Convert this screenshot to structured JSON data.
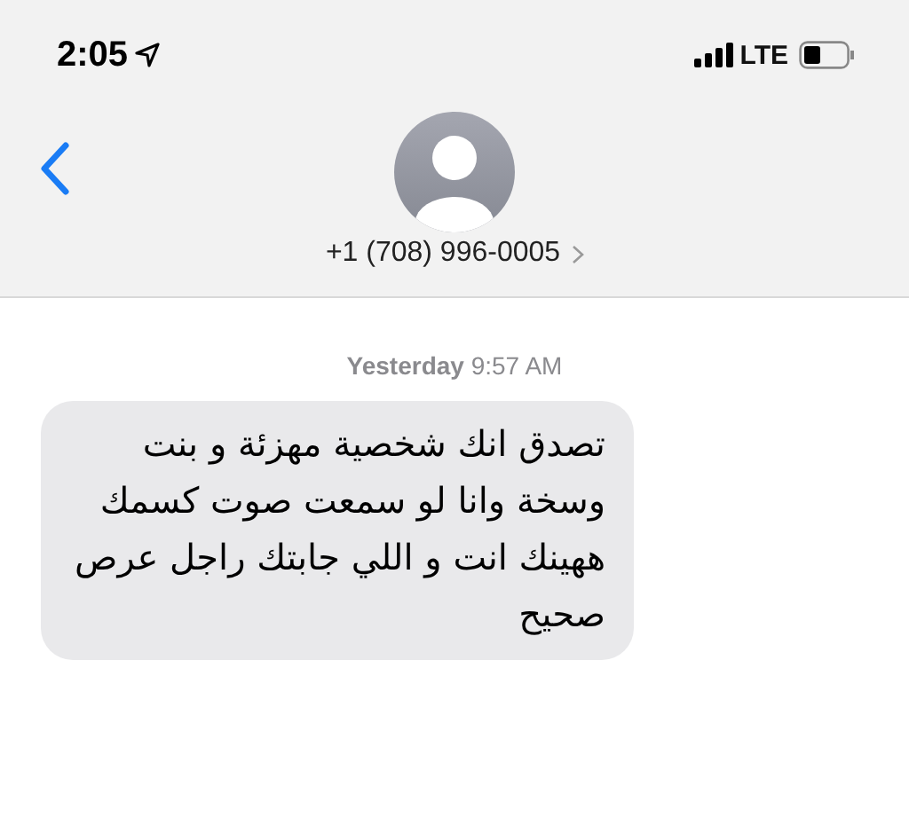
{
  "status_bar": {
    "time": "2:05",
    "network": "LTE"
  },
  "contact": {
    "phone": "+1 (708) 996-0005"
  },
  "timestamp": {
    "day": "Yesterday",
    "time": "9:57 AM"
  },
  "messages": [
    {
      "kind": "received",
      "text": "تصدق انك شخصية مهزئة و بنت وسخة وانا لو سمعت صوت كسمك ههينك انت و اللي جابتك راجل عرص صحيح"
    }
  ]
}
